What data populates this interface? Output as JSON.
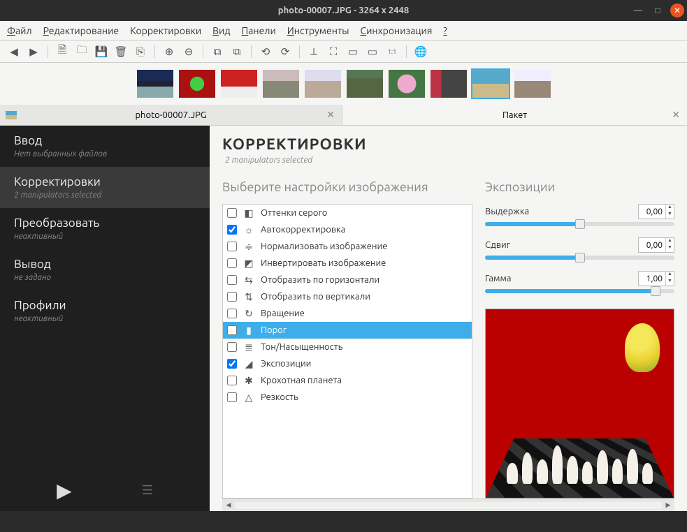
{
  "titlebar": {
    "title": "photo-00007.JPG  - 3264 x 2448"
  },
  "menu": {
    "file": "Файл",
    "edit": "Редактирование",
    "adjust": "Корректировки",
    "view": "Вид",
    "panels": "Панели",
    "tools": "Инструменты",
    "sync": "Синхронизация",
    "help": "?"
  },
  "filetab": {
    "label": "photo-00007.JPG"
  },
  "batchtab": {
    "label": "Пакет"
  },
  "sidebar": {
    "items": [
      {
        "label": "Ввод",
        "sub": "Нет выбранных файлов"
      },
      {
        "label": "Корректировки",
        "sub": "2 manipulators selected"
      },
      {
        "label": "Преобразовать",
        "sub": "неактивный"
      },
      {
        "label": "Вывод",
        "sub": "не задано"
      },
      {
        "label": "Профили",
        "sub": "неактивный"
      }
    ]
  },
  "content": {
    "title": "КОРРЕКТИРОВКИ",
    "sub": "2 manipulators selected",
    "leftHead": "Выберите настройки изображения",
    "rightHead": "Экспозиции",
    "adjustments": [
      {
        "label": "Оттенки серого",
        "checked": false,
        "icon": "◧"
      },
      {
        "label": "Автокорректировка",
        "checked": true,
        "icon": "☼"
      },
      {
        "label": "Нормализовать изображение",
        "checked": false,
        "icon": "≑"
      },
      {
        "label": "Инвертировать изображение",
        "checked": false,
        "icon": "◩"
      },
      {
        "label": "Отобразить по горизонтали",
        "checked": false,
        "icon": "⇆"
      },
      {
        "label": "Отобразить по вертикали",
        "checked": false,
        "icon": "⇅"
      },
      {
        "label": "Вращение",
        "checked": false,
        "icon": "↻"
      },
      {
        "label": "Порог",
        "checked": false,
        "icon": "▮",
        "selected": true
      },
      {
        "label": "Тон/Насыщенность",
        "checked": false,
        "icon": "≣"
      },
      {
        "label": "Экспозиции",
        "checked": true,
        "icon": "◢"
      },
      {
        "label": "Крохотная планета",
        "checked": false,
        "icon": "✱"
      },
      {
        "label": "Резкость",
        "checked": false,
        "icon": "△"
      }
    ],
    "sliders": [
      {
        "label": "Выдержка",
        "value": "0,00",
        "pos": 50
      },
      {
        "label": "Сдвиг",
        "value": "0,00",
        "pos": 50
      },
      {
        "label": "Гамма",
        "value": "1,00",
        "pos": 90
      }
    ]
  }
}
